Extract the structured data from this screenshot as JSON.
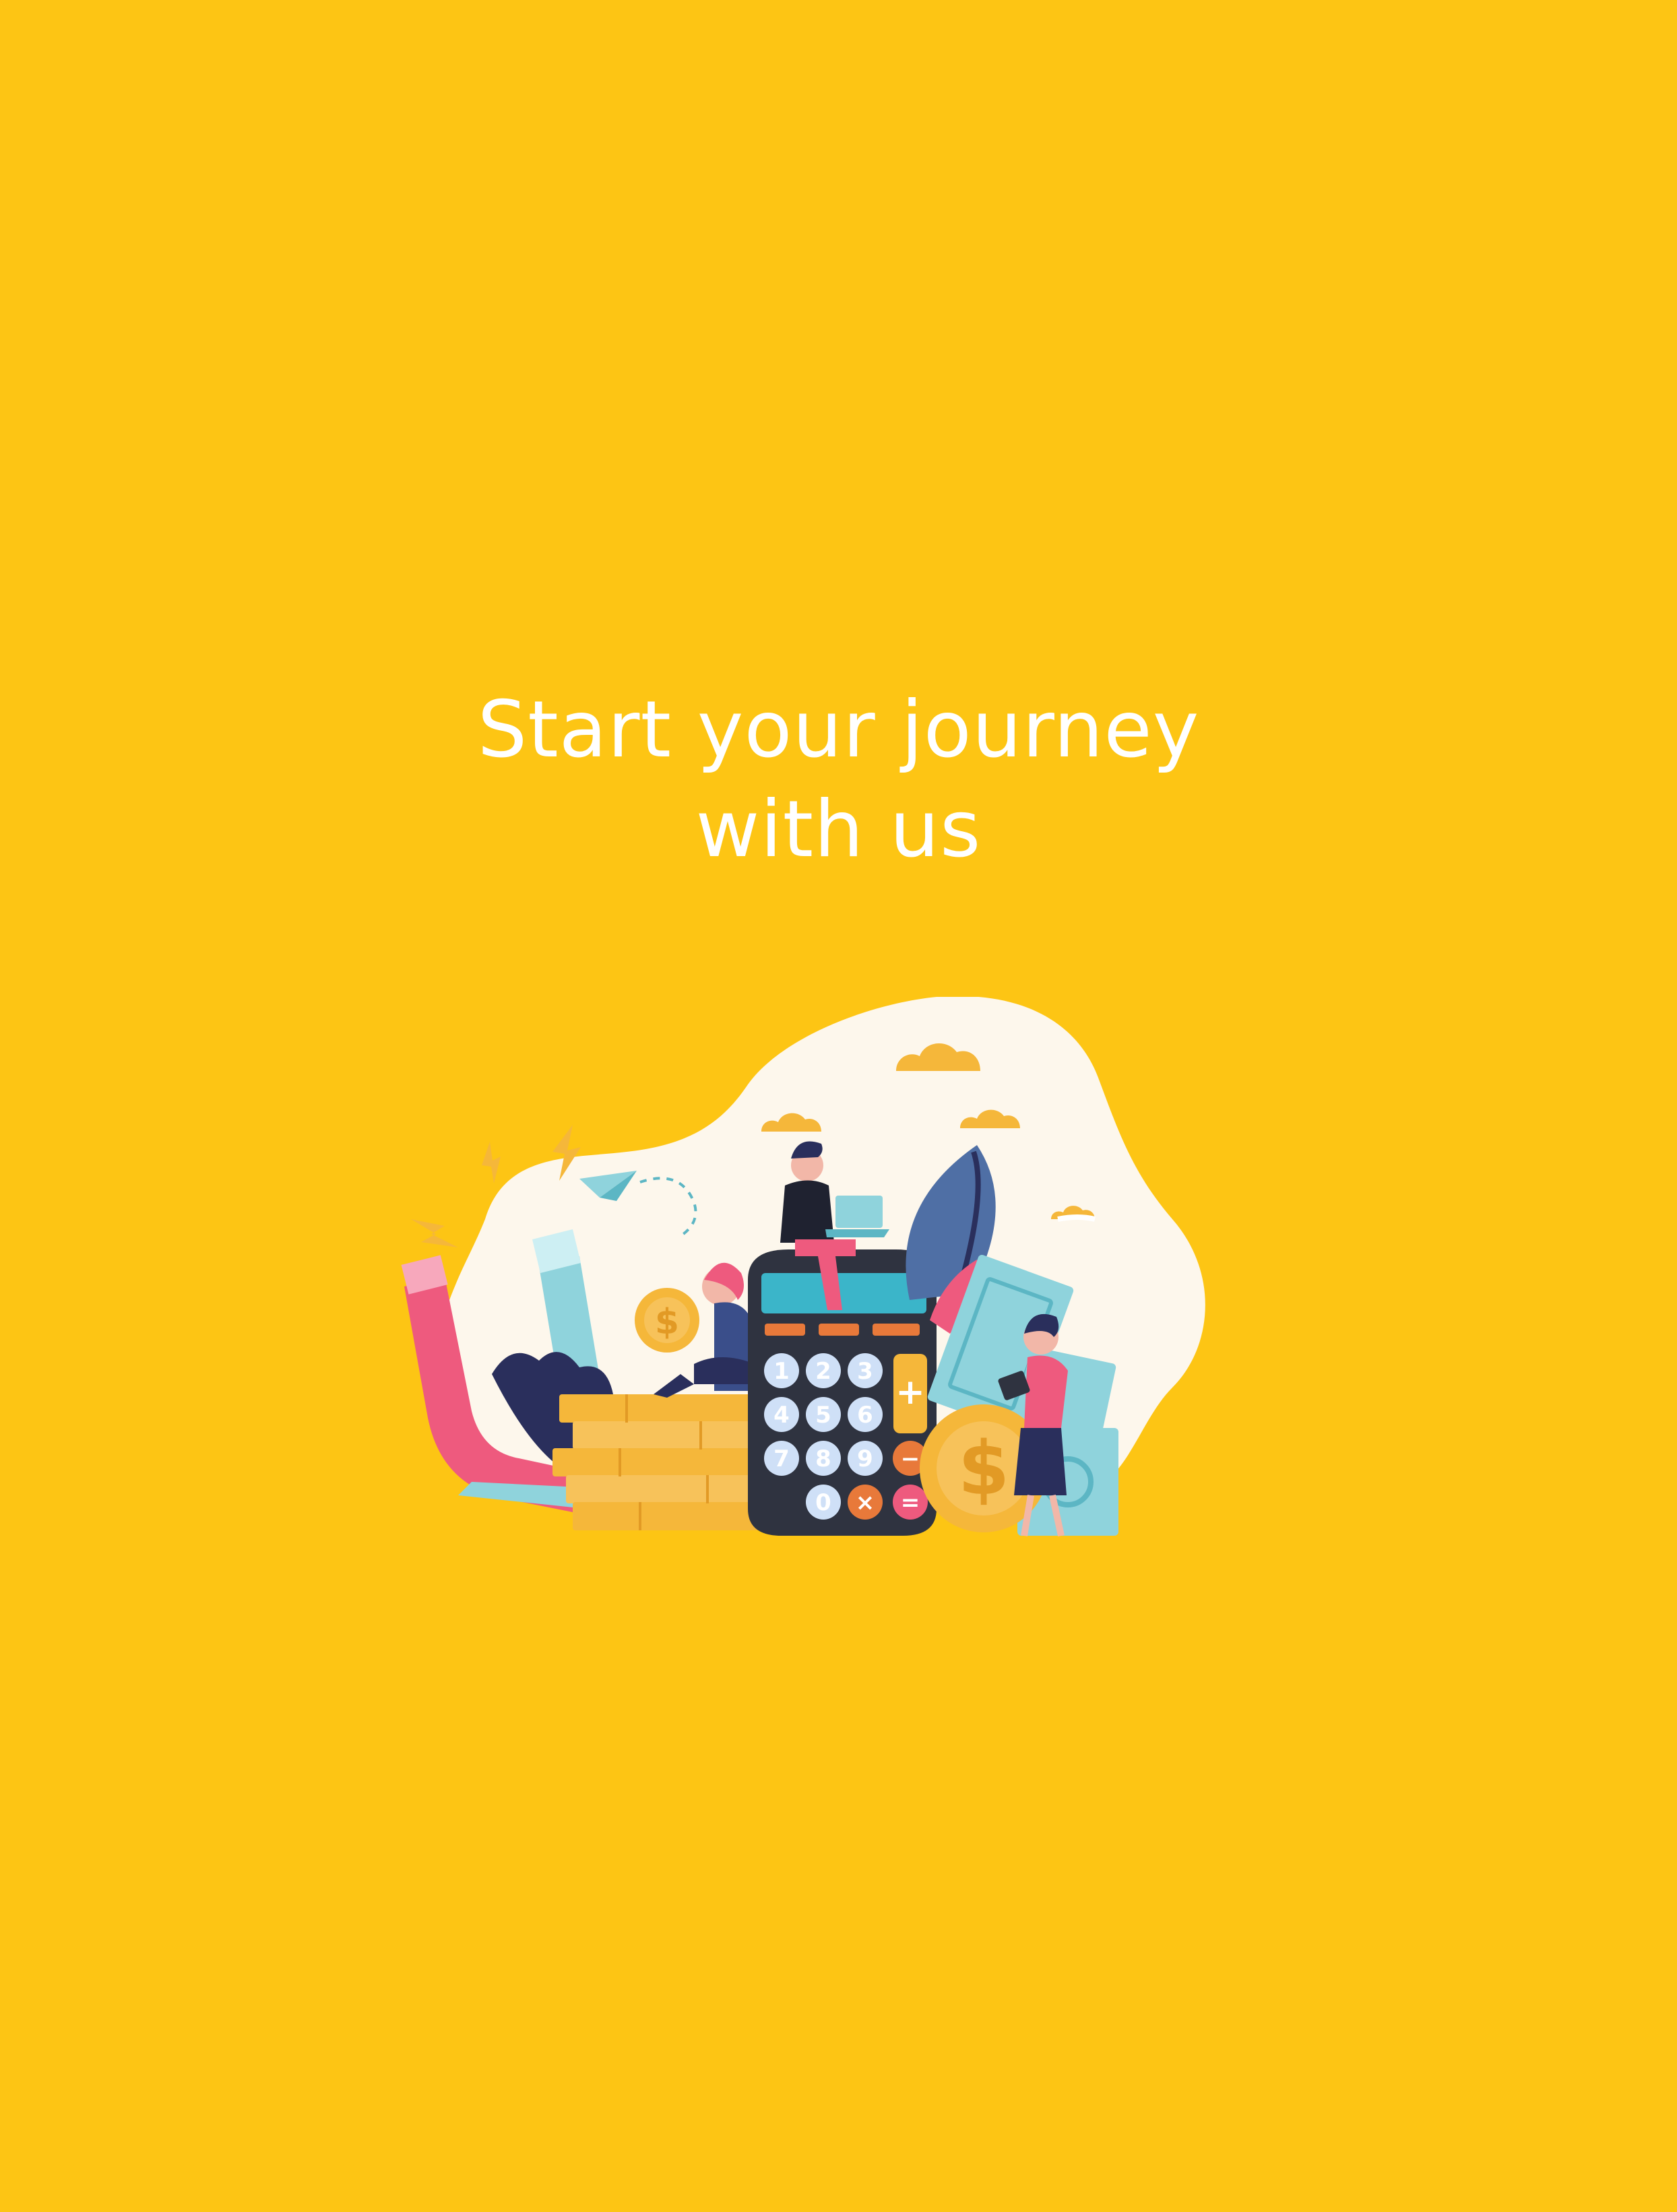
{
  "hero": {
    "headline_line1": "Start your journey",
    "headline_line2": "with us"
  },
  "calculator": {
    "keys": [
      "1",
      "2",
      "3",
      "+",
      "4",
      "5",
      "6",
      "7",
      "8",
      "9",
      "−",
      "0",
      "×",
      "="
    ]
  },
  "coin_symbol": "$",
  "colors": {
    "background": "#FDC514",
    "headline": "#FFFFFF",
    "blob": "#FDF7EC",
    "coin": "#F5B73A",
    "calculator_body": "#2F3340",
    "calculator_screen": "#3BB5C9",
    "accent_pink": "#EE5A7E",
    "accent_teal": "#8FD3DC"
  },
  "icons": [
    "finance-illustration",
    "calculator-icon",
    "coin-icon",
    "magnet-icon",
    "paper-plane-icon",
    "cloud-icon",
    "banknote-icon",
    "lightning-icon",
    "leaf-icon"
  ]
}
